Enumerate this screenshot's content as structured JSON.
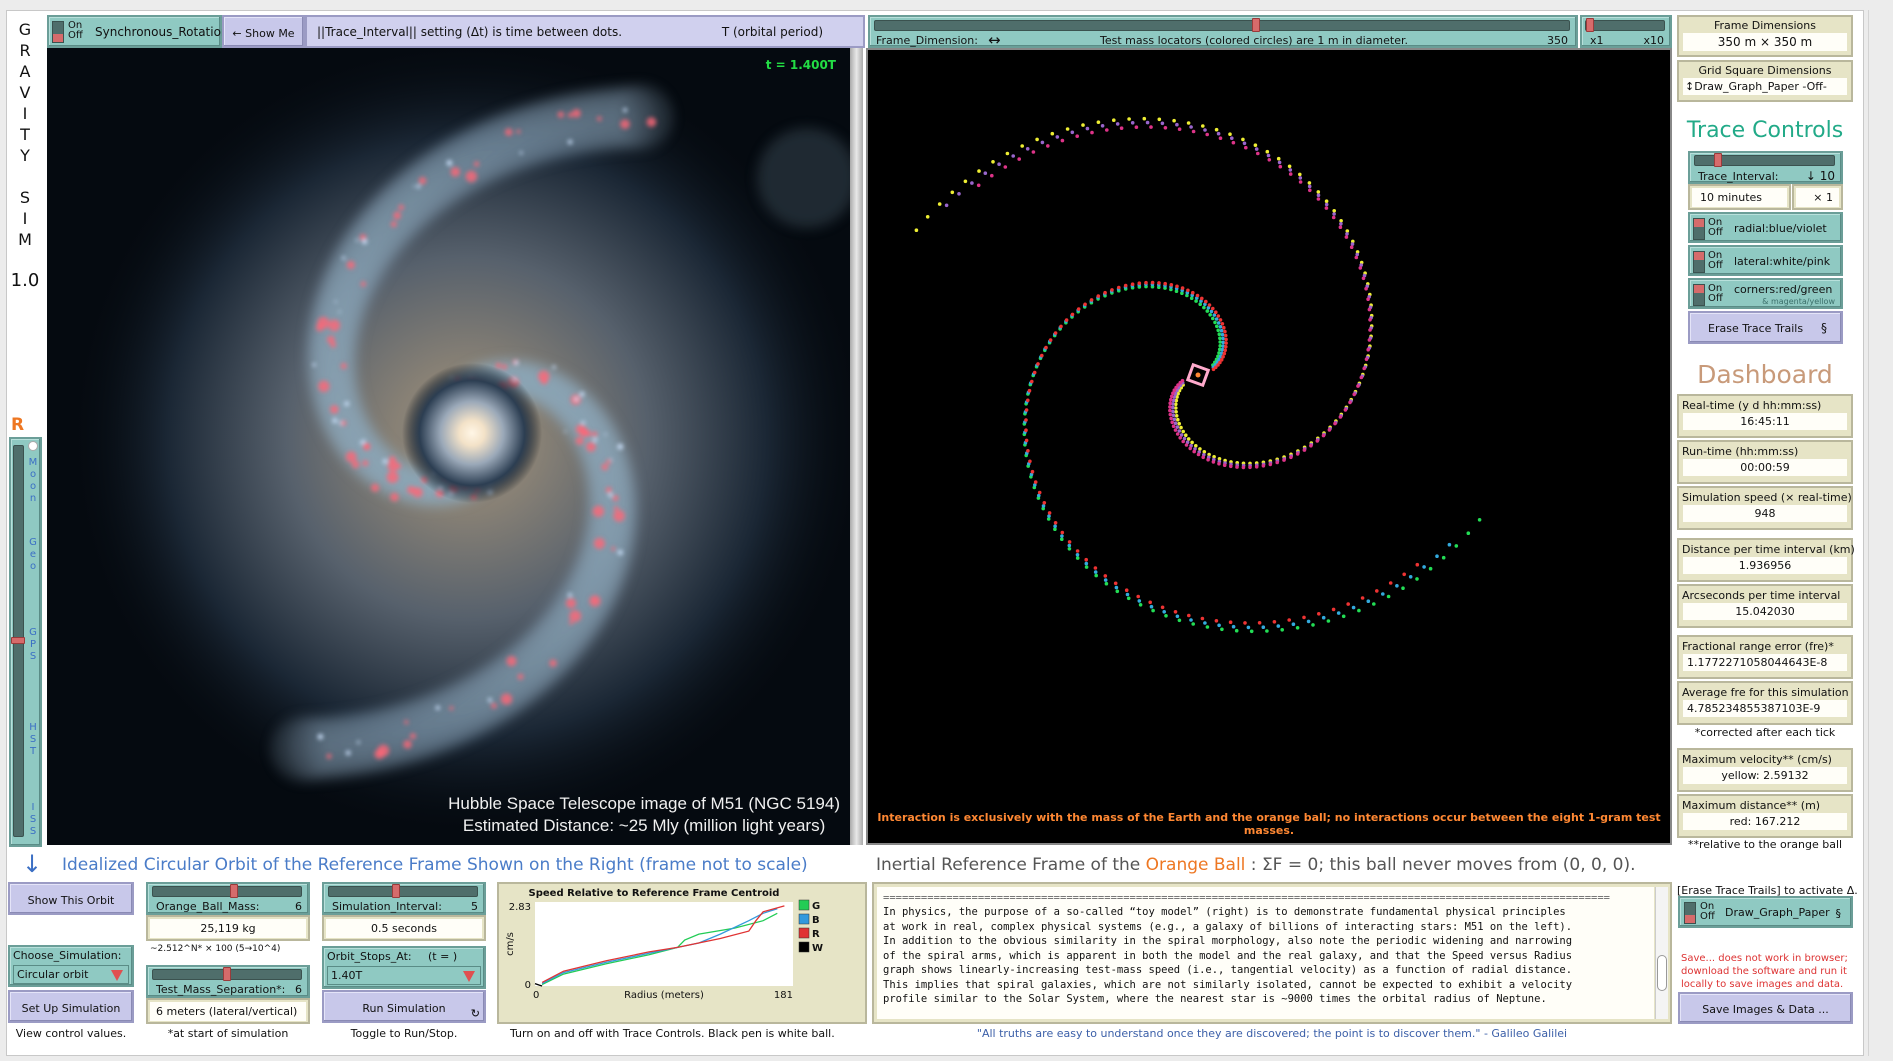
{
  "app": {
    "title_letters": [
      "G",
      "R",
      "A",
      "V",
      "I",
      "T",
      "Y",
      "",
      "S",
      "I",
      "M"
    ],
    "version": "1.0"
  },
  "toolbar": {
    "sync_rotation": {
      "on": "On",
      "off": "Off",
      "label": "Synchronous_Rotation",
      "state": "off"
    },
    "show_me_label": "← Show Me",
    "trace_info": "||Trace_Interval|| setting (Δt) is time between dots.",
    "orbital_period": "T (orbital period)",
    "frame_dimension": {
      "label": "Frame_Dimension:",
      "arrow": "↔",
      "note": "Test mass locators (colored circles) are 1 m in diameter.",
      "value": "350",
      "fraction": 0.55
    },
    "zoom_slider": {
      "min_label": "x1",
      "max_label": "x10",
      "fraction": 0.0
    }
  },
  "left_strip": {
    "r_label": "R",
    "orbit_slider_labels": [
      "Moon",
      "Geo",
      "GPS",
      "HST",
      "ISS"
    ],
    "orbit_slider_fraction": 0.5
  },
  "galaxy_panel": {
    "time_label": "t = 1.400T",
    "caption_line1": "Hubble Space Telescope image of M51 (NGC 5194)",
    "caption_line2": "Estimated Distance: ~25 Mly (million light years)"
  },
  "sim_panel": {
    "footer_note": "Interaction is exclusively with the mass of the Earth and the orange ball; no interactions occur between the eight 1-gram test masses.",
    "trail_colors": {
      "green": "#22dd55",
      "blue": "#33aadd",
      "red": "#ee3333",
      "yellow": "#eeee33",
      "violet": "#9966cc",
      "magenta": "#dd3388",
      "white": "#ffffff",
      "pink": "#ffaacc"
    }
  },
  "right_panel": {
    "frame_dimensions": {
      "label": "Frame Dimensions",
      "value": "350 m × 350 m"
    },
    "grid_square": {
      "label": "Grid Square Dimensions",
      "value": "↕Draw_Graph_Paper -Off-"
    },
    "trace_controls_heading": "Trace Controls",
    "trace_interval": {
      "label": "Trace_Interval:",
      "value": "↓ 10",
      "fraction": 0.15,
      "display": "10 minutes",
      "multiplier": "× 1"
    },
    "switches": [
      {
        "on": "On",
        "off": "Off",
        "label": "radial:blue/violet",
        "sub": "",
        "state": "on"
      },
      {
        "on": "On",
        "off": "Off",
        "label": "lateral:white/pink",
        "sub": "",
        "state": "on"
      },
      {
        "on": "On",
        "off": "Off",
        "label": "corners:red/green",
        "sub": "& magenta/yellow",
        "state": "on"
      }
    ],
    "erase_button": "Erase Trace Trails",
    "section_mark": "§",
    "dashboard_heading": "Dashboard",
    "monitors": [
      {
        "label": "Real-time (y d hh:mm:ss)",
        "value": "16:45:11"
      },
      {
        "label": "Run-time (hh:mm:ss)",
        "value": "00:00:59"
      },
      {
        "label": "Simulation speed (× real-time)",
        "value": "948"
      },
      {
        "label": "Distance per time interval (km)",
        "value": "1.936956"
      },
      {
        "label": "Arcseconds per time interval",
        "value": "15.042030"
      },
      {
        "label": "Fractional range error (fre)*",
        "value": "1.1772271058044643E-8"
      },
      {
        "label": "Average fre for this simulation",
        "value": "4.785234855387103E-9"
      },
      {
        "label": "Maximum velocity** (cm/s)",
        "value": "yellow: 2.59132"
      },
      {
        "label": "Maximum distance** (m)",
        "value": "red: 167.212"
      }
    ],
    "corrected_note": "*corrected after each tick",
    "relative_note": "**relative to the orange ball",
    "erase_activate_note": "[Erase Trace Trails] to activate Δ.",
    "graph_paper_switch": {
      "on": "On",
      "off": "Off",
      "label": "Draw_Graph_Paper",
      "state": "off"
    },
    "save_warning": "Save... does not work in browser; download the software and run it locally to save images and data.",
    "save_button": "Save Images & Data ..."
  },
  "headings": {
    "orbit_arrow": "↓",
    "left_heading": "Idealized Circular Orbit of the Reference Frame Shown on the Right (frame not to scale)",
    "right_heading_pre": "Inertial Reference Frame of the ",
    "right_heading_ball": "Orange Ball",
    "right_heading_post": " : ΣF = 0; this ball never moves from (0, 0, 0)."
  },
  "controls": {
    "show_orbit_button": "Show This Orbit",
    "choose_simulation": {
      "label": "Choose_Simulation:",
      "value": "Circular orbit"
    },
    "setup_button": "Set Up Simulation",
    "setup_note": "View control values.",
    "orange_ball_mass": {
      "label": "Orange_Ball_Mass:",
      "value": "6",
      "fraction": 0.55,
      "display": "25,119 kg",
      "note": "~2.512^N* × 100   (5→10^4)"
    },
    "test_mass_separation": {
      "label": "Test_Mass_Separation*:",
      "value": "6",
      "fraction": 0.5,
      "display": "6 meters (lateral/vertical)",
      "note": "*at start of simulation"
    },
    "simulation_interval": {
      "label": "Simulation_Interval:",
      "value": "5",
      "fraction": 0.45,
      "display": "0.5 seconds"
    },
    "orbit_stops_at": {
      "label": "Orbit_Stops_At:",
      "suffix": "(t = )",
      "value": "1.40T"
    },
    "run_button": "Run Simulation",
    "run_note": "Toggle to Run/Stop."
  },
  "plot_note": "Turn on and off with Trace Controls. Black pen is white ball.",
  "info_text": {
    "divider": "===================================================================================================================",
    "lines": [
      "In physics, the purpose of a so-called “toy model” (right) is to demonstrate fundamental physical principles",
      "at work in real, complex physical systems (e.g., a galaxy of billions of interacting stars: M51 on the left).",
      "In addition to the obvious similarity in the spiral morphology, also note the periodic widening and narrowing",
      "of the spiral arms, which is apparent in both the model and the real galaxy, and that the Speed versus Radius",
      "graph shows linearly-increasing test-mass speed (i.e., tangential velocity) as a function of radial distance.",
      "This implies that spiral galaxies, which are not similarly isolated, cannot be expected to exhibit a velocity",
      "profile similar to the Solar System, where the nearest star is ~9000 times the orbital radius of Neptune."
    ],
    "quote": "\"All truths are easy to understand once they are discovered; the point is to discover them.\" - Galileo Galilei"
  },
  "chart_data": {
    "type": "line",
    "title": "Speed Relative to Reference Frame Centroid",
    "xlabel": "Radius (meters)",
    "ylabel": "cm/s",
    "xlim": [
      0,
      181
    ],
    "ylim": [
      0,
      2.83
    ],
    "x_tick_labels": [
      "0",
      "181"
    ],
    "y_tick_labels": [
      "0",
      "2.83"
    ],
    "legend": [
      {
        "name": "G",
        "color": "#22cc55"
      },
      {
        "name": "B",
        "color": "#3399dd"
      },
      {
        "name": "R",
        "color": "#e03333"
      },
      {
        "name": "W",
        "color": "#000000"
      }
    ],
    "legend_position": "right",
    "series": [
      {
        "name": "G",
        "x": [
          5,
          20,
          50,
          80,
          100,
          105,
          115,
          140,
          160,
          170
        ],
        "y": [
          0.05,
          0.4,
          0.75,
          1.05,
          1.3,
          1.55,
          1.75,
          1.95,
          2.2,
          2.45
        ]
      },
      {
        "name": "B",
        "x": [
          5,
          20,
          50,
          80,
          100,
          115,
          130,
          150,
          160,
          170
        ],
        "y": [
          0.08,
          0.45,
          0.8,
          1.1,
          1.3,
          1.45,
          1.75,
          2.2,
          2.45,
          2.6
        ]
      },
      {
        "name": "R",
        "x": [
          5,
          20,
          50,
          80,
          100,
          130,
          150,
          155,
          160,
          175
        ],
        "y": [
          0.12,
          0.5,
          0.85,
          1.15,
          1.3,
          1.6,
          1.85,
          2.2,
          2.5,
          2.7
        ]
      },
      {
        "name": "W",
        "x": [
          0,
          3,
          5
        ],
        "y": [
          0.08,
          0.03,
          0.0
        ]
      }
    ]
  }
}
